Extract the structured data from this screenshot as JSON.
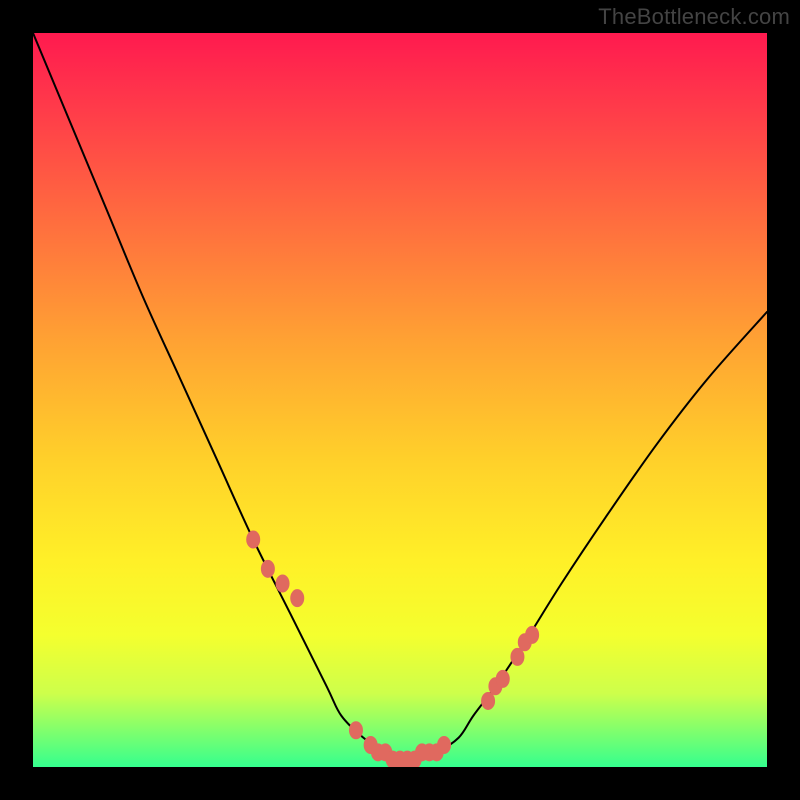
{
  "watermark": "TheBottleneck.com",
  "chart_data": {
    "type": "line",
    "title": "",
    "xlabel": "",
    "ylabel": "",
    "xlim": [
      0,
      100
    ],
    "ylim": [
      0,
      100
    ],
    "grid": false,
    "legend": false,
    "annotations": [],
    "series": [
      {
        "name": "curve",
        "x": [
          0,
          5,
          10,
          15,
          20,
          25,
          30,
          35,
          40,
          42,
          45,
          48,
          50,
          52,
          55,
          58,
          60,
          63,
          67,
          72,
          78,
          85,
          92,
          100
        ],
        "values": [
          100,
          88,
          76,
          64,
          53,
          42,
          31,
          21,
          11,
          7,
          4,
          2,
          1,
          1,
          2,
          4,
          7,
          11,
          17,
          25,
          34,
          44,
          53,
          62
        ]
      }
    ],
    "markers": {
      "name": "highlight-dots",
      "color": "#e0695f",
      "x": [
        30,
        32,
        34,
        36,
        44,
        46,
        47,
        48,
        49,
        50,
        51,
        52,
        53,
        54,
        55,
        56,
        62,
        63,
        64,
        66,
        67,
        68
      ],
      "values": [
        31,
        27,
        25,
        23,
        5,
        3,
        2,
        2,
        1,
        1,
        1,
        1,
        2,
        2,
        2,
        3,
        9,
        11,
        12,
        15,
        17,
        18
      ]
    },
    "background_gradient": {
      "direction": "vertical",
      "stops": [
        {
          "pos": 0.0,
          "color": "#ff1a4f"
        },
        {
          "pos": 0.1,
          "color": "#ff3a4a"
        },
        {
          "pos": 0.25,
          "color": "#ff6b3f"
        },
        {
          "pos": 0.42,
          "color": "#ffa233"
        },
        {
          "pos": 0.58,
          "color": "#ffd02a"
        },
        {
          "pos": 0.72,
          "color": "#fff028"
        },
        {
          "pos": 0.82,
          "color": "#f4ff2e"
        },
        {
          "pos": 0.9,
          "color": "#cdff4b"
        },
        {
          "pos": 1.0,
          "color": "#35ff8e"
        }
      ]
    }
  }
}
